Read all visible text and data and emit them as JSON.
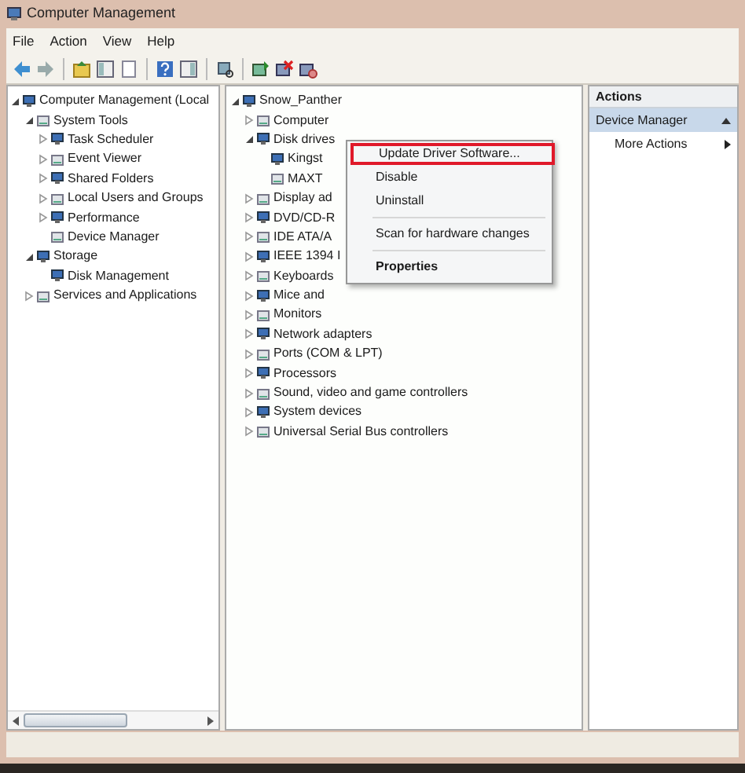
{
  "window": {
    "title": "Computer Management"
  },
  "menu_bar": [
    "File",
    "Action",
    "View",
    "Help"
  ],
  "console_tree": [
    {
      "label": "Computer Management (Local",
      "expanded": true,
      "children": [
        {
          "label": "System Tools",
          "expanded": true,
          "children": [
            {
              "label": "Task Scheduler",
              "expanded": false
            },
            {
              "label": "Event Viewer",
              "expanded": false
            },
            {
              "label": "Shared Folders",
              "expanded": false
            },
            {
              "label": "Local Users and Groups",
              "expanded": false
            },
            {
              "label": "Performance",
              "expanded": false
            },
            {
              "label": "Device Manager"
            }
          ]
        },
        {
          "label": "Storage",
          "expanded": true,
          "children": [
            {
              "label": "Disk Management"
            }
          ]
        },
        {
          "label": "Services and Applications",
          "expanded": false
        }
      ]
    }
  ],
  "device_tree": [
    {
      "label": "Snow_Panther",
      "expanded": true,
      "children": [
        {
          "label": "Computer",
          "expanded": false
        },
        {
          "label": "Disk drives",
          "expanded": true,
          "children": [
            {
              "label": "Kingst"
            },
            {
              "label": "MAXT"
            }
          ]
        },
        {
          "label": "Display ad",
          "expanded": false
        },
        {
          "label": "DVD/CD-R",
          "expanded": false
        },
        {
          "label": "IDE ATA/A",
          "expanded": false
        },
        {
          "label": "IEEE 1394 I",
          "expanded": false
        },
        {
          "label": "Keyboards",
          "expanded": false
        },
        {
          "label": "Mice and",
          "expanded": false
        },
        {
          "label": "Monitors",
          "expanded": false
        },
        {
          "label": "Network adapters",
          "expanded": false
        },
        {
          "label": "Ports (COM & LPT)",
          "expanded": false
        },
        {
          "label": "Processors",
          "expanded": false
        },
        {
          "label": "Sound, video and game controllers",
          "expanded": false
        },
        {
          "label": "System devices",
          "expanded": false
        },
        {
          "label": "Universal Serial Bus controllers",
          "expanded": false
        }
      ]
    }
  ],
  "context_menu": [
    {
      "kind": "item",
      "label": "Update Driver Software...",
      "highlighted": true
    },
    {
      "kind": "item",
      "label": "Disable",
      "highlighted": false
    },
    {
      "kind": "item",
      "label": "Uninstall",
      "highlighted": false
    },
    {
      "kind": "separator"
    },
    {
      "kind": "item",
      "label": "Scan for hardware changes",
      "highlighted": false
    },
    {
      "kind": "separator"
    },
    {
      "kind": "default",
      "label": "Properties",
      "highlighted": false
    }
  ],
  "actions_pane": {
    "title": "Actions",
    "section": "Device Manager",
    "items": [
      "More Actions"
    ]
  }
}
